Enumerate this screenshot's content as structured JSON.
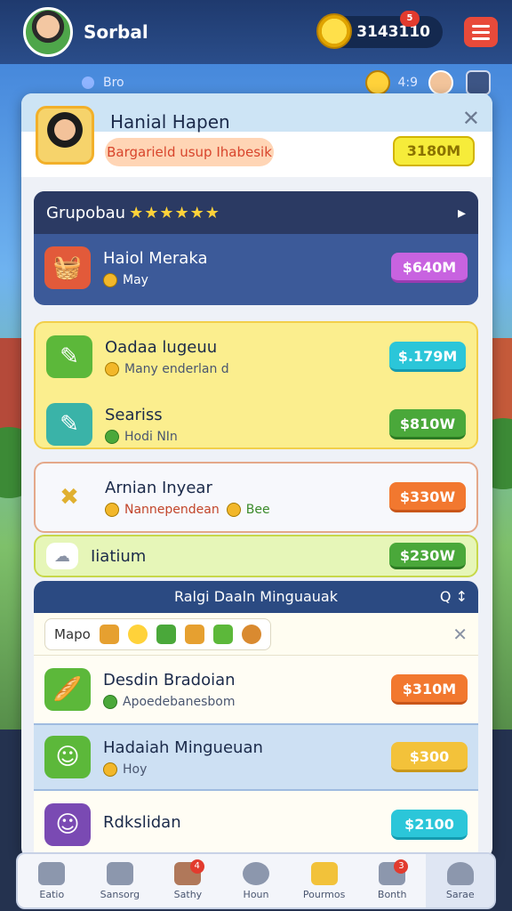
{
  "topbar": {
    "player_name": "Sorbal",
    "coins": "3143110",
    "coin_badge": "5"
  },
  "subbar": {
    "label": "Bro",
    "count": "4:9"
  },
  "panel": {
    "name": "Hanial Hapen",
    "tag": "Bargarield usup Ihabesik",
    "price": "3180M"
  },
  "group1": {
    "title": "Grupobau",
    "stars": "★★★★★★",
    "row": {
      "title": "Haiol Meraka",
      "sub": "May",
      "price": "$640M"
    }
  },
  "group2": {
    "rows": [
      {
        "title": "Oadaa lugeuu",
        "sub": "Many enderlan d",
        "price": "$.179M"
      },
      {
        "title": "Seariss",
        "sub": "Hodi NIn",
        "price": "$810W"
      }
    ]
  },
  "group3": {
    "title": "Arnian Inyear",
    "sub": "Nannependean",
    "sub2": "Bee",
    "price": "$330W"
  },
  "group4": {
    "title": "Iiatium",
    "price": "$230W"
  },
  "section2": {
    "title": "Ralgi Daaln Minguauak",
    "tools": "Q ↕",
    "filter_label": "Mapo",
    "rows": [
      {
        "title": "Desdin Bradoian",
        "sub": "Apoedebanesbom",
        "price": "$310M"
      },
      {
        "title": "Hadaiah Mingueuan",
        "sub": "Hoy",
        "price": "$300"
      },
      {
        "title": "Rdkslidan",
        "sub": "",
        "price": "$2100"
      }
    ]
  },
  "nav": [
    {
      "label": "Eatio"
    },
    {
      "label": "Sansorg"
    },
    {
      "label": "Sathy",
      "badge": "4"
    },
    {
      "label": "Houn"
    },
    {
      "label": "Pourmos"
    },
    {
      "label": "Bonth",
      "badge": "3"
    },
    {
      "label": "Sarae"
    }
  ]
}
